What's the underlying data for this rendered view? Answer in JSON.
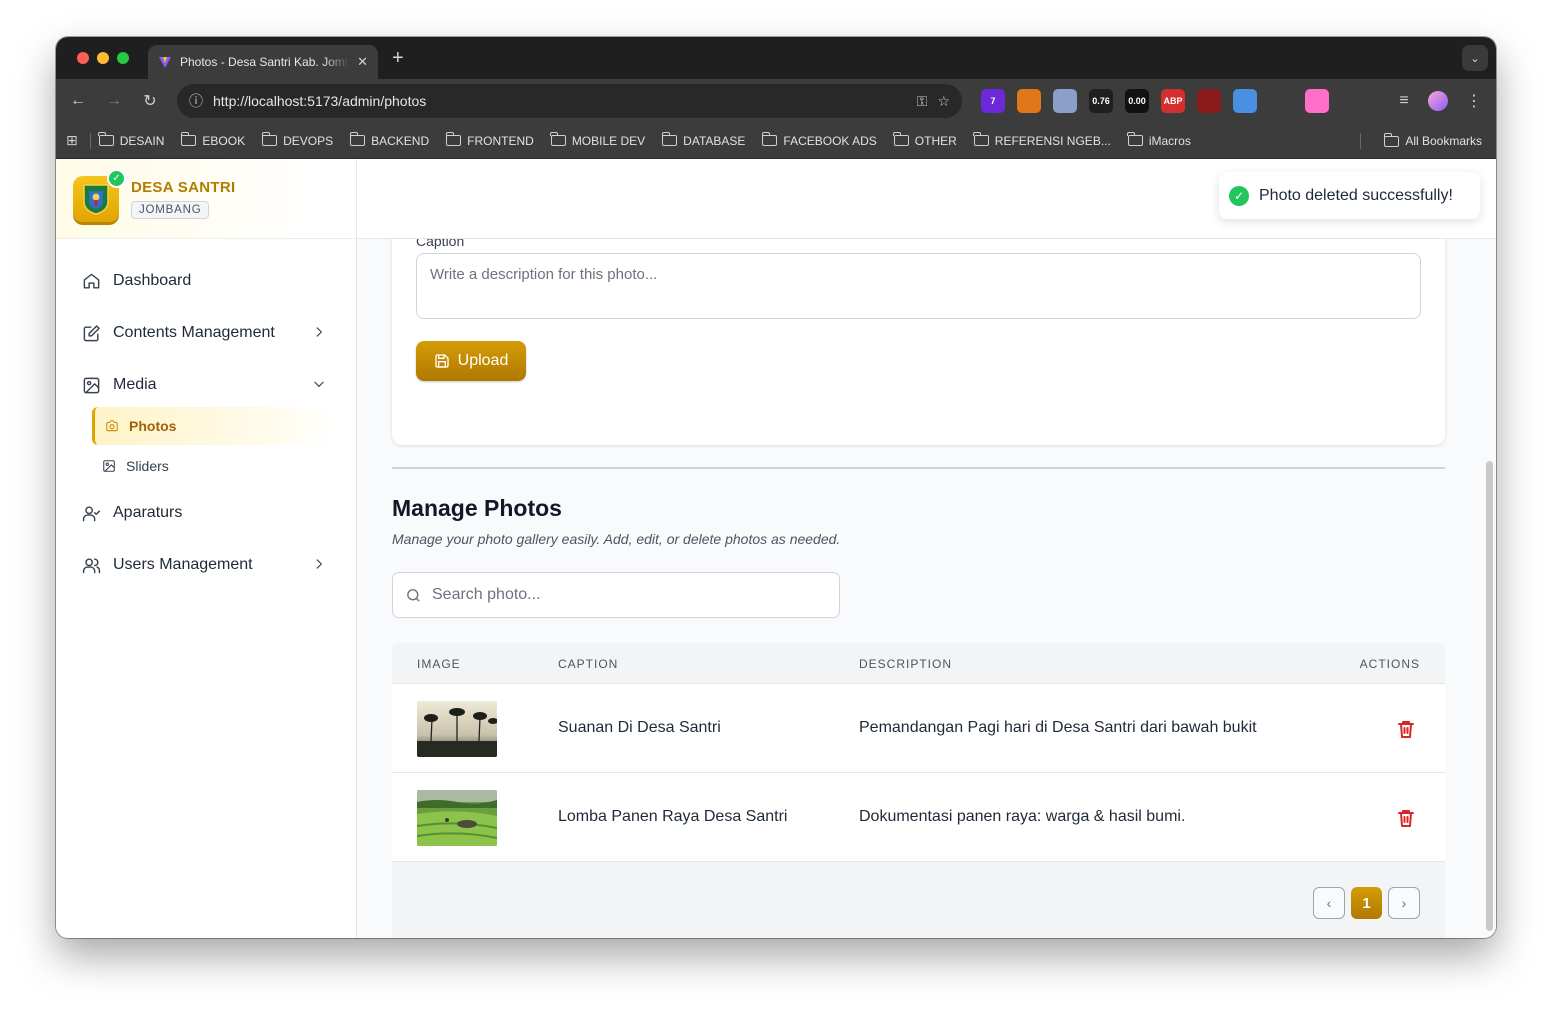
{
  "browser": {
    "tab_title": "Photos - Desa Santri Kab. Jombang",
    "url": "http://localhost:5173/admin/photos",
    "extensions": [
      {
        "name": "wappalyzer-extension-icon",
        "label": "7",
        "color": "#6d28d9"
      },
      {
        "name": "metamask-extension-icon",
        "label": "",
        "color": "#e2761b"
      },
      {
        "name": "ghost-extension-icon",
        "label": "",
        "color": "#8aa0c8"
      },
      {
        "name": "lcp-extension-icon",
        "label": "0.76",
        "color": "#1f1f1f"
      },
      {
        "name": "cls-extension-icon",
        "label": "0.00",
        "color": "#111111"
      },
      {
        "name": "adblock-plus-extension-icon",
        "label": "ABP",
        "color": "#d32f2f"
      },
      {
        "name": "ublock-extension-icon",
        "label": "",
        "color": "#8b1a1a"
      },
      {
        "name": "docs-extension-icon",
        "label": "",
        "color": "#4a90e2"
      },
      {
        "name": "screenshot-extension-icon",
        "label": "",
        "color": "#3c3c3c"
      },
      {
        "name": "colorzilla-extension-icon",
        "label": "",
        "color": "#ff6ec7"
      },
      {
        "name": "extensions-puzzle-icon",
        "label": "",
        "color": "#3c3c3c"
      }
    ],
    "bookmarks": [
      "DESAIN",
      "EBOOK",
      "DEVOPS",
      "BACKEND",
      "FRONTEND",
      "MOBILE DEV",
      "DATABASE",
      "FACEBOOK ADS",
      "OTHER",
      "REFERENSI NGEB...",
      "iMacros"
    ],
    "all_bookmarks": "All Bookmarks"
  },
  "brand": {
    "name": "DESA SANTRI",
    "region": "JOMBANG",
    "accent": "#b07d00"
  },
  "sidebar": {
    "items": [
      {
        "label": "Dashboard"
      },
      {
        "label": "Contents Management"
      },
      {
        "label": "Media"
      },
      {
        "label": "Aparaturs"
      },
      {
        "label": "Users Management"
      }
    ],
    "media_sub": [
      {
        "label": "Photos",
        "active": true
      },
      {
        "label": "Sliders",
        "active": false
      }
    ]
  },
  "upload": {
    "caption_label": "Caption",
    "caption_placeholder": "Write a description for this photo...",
    "button_label": "Upload"
  },
  "manage": {
    "title": "Manage Photos",
    "subtitle": "Manage your photo gallery easily. Add, edit, or delete photos as needed.",
    "search_placeholder": "Search photo..."
  },
  "table": {
    "headers": [
      "IMAGE",
      "CAPTION",
      "DESCRIPTION",
      "ACTIONS"
    ],
    "rows": [
      {
        "caption": "Suanan Di Desa Santri",
        "description": "Pemandangan Pagi hari di Desa Santri dari bawah bukit"
      },
      {
        "caption": "Lomba Panen Raya Desa Santri",
        "description": "Dokumentasi panen raya: warga & hasil bumi."
      }
    ]
  },
  "pagination": {
    "prev": "‹",
    "current": "1",
    "next": "›"
  },
  "toast": {
    "message": "Photo deleted successfully!",
    "status_color": "#22c55e"
  }
}
